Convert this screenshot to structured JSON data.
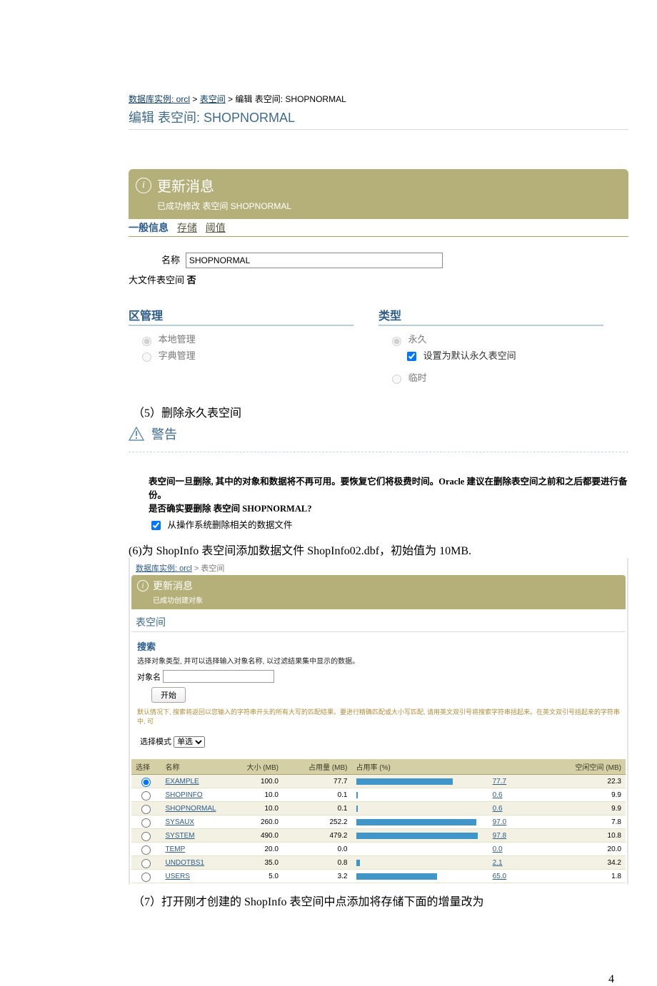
{
  "breadcrumb": {
    "db_link": "数据库实例: orcl",
    "ts_link": "表空间",
    "current": "编辑 表空间: SHOPNORMAL"
  },
  "page_title": "编辑 表空间: SHOPNORMAL",
  "update": {
    "title": "更新消息",
    "msg": "已成功修改 表空间 SHOPNORMAL"
  },
  "tabs": {
    "general": "一般信息",
    "storage": "存储",
    "threshold": "阈值"
  },
  "form": {
    "name_label": "名称",
    "name_value": "SHOPNORMAL",
    "bigfile_label": "大文件表空间",
    "bigfile_value": "否"
  },
  "section": {
    "extent": "区管理",
    "extent_local": "本地管理",
    "extent_dict": "字典管理",
    "type": "类型",
    "type_perm": "永久",
    "type_default_chk": "设置为默认永久表空间",
    "type_temp": "临时"
  },
  "step5": "（5）删除永久表空间",
  "warn": {
    "title": "警告",
    "line1a": "表空间一旦删除, 其中的对象和数据将不再可用。要恢复它们将极费时间。Oracle 建议在删除表空间之前和之后都要进行备份。",
    "line2": "是否确实要删除 表空间  SHOPNORMAL?",
    "checkbox": "从操作系统删除相关的数据文件"
  },
  "step6": "(6)为 ShopInfo 表空间添加数据文件 ShopInfo02.dbf，初始值为 10MB.",
  "inner_breadcrumb": {
    "db_link": "数据库实例: orcl",
    "current": "表空间"
  },
  "update2": {
    "title": "更新消息",
    "msg": "已成功创建对象"
  },
  "inner_title": "表空间",
  "search": {
    "title": "搜索",
    "desc": "选择对象类型, 并可以选择输入对象名称, 以过滤结果集中显示的数据。",
    "obj_label": "对象名",
    "start_btn": "开始",
    "hint": "默认情况下, 搜索将返回以您输入的字符串开头的所有大写的匹配结果。要进行精确匹配或大小写匹配, 请用英文双引号将搜索字符串括起来。在英文双引号括起来的字符串中, 可",
    "mode_label": "选择模式",
    "mode_value": "单选"
  },
  "table": {
    "headers": {
      "select": "选择",
      "name": "名称",
      "size": "大小  (MB)",
      "used": "占用量  (MB)",
      "pct": "占用率 (%)",
      "free": "空闲空间  (MB)"
    },
    "rows": [
      {
        "name": "EXAMPLE",
        "size": "100.0",
        "used": "77.7",
        "pct": "77.7",
        "bar": 135,
        "free": "22.3"
      },
      {
        "name": "SHOPINFO",
        "size": "10.0",
        "used": "0.1",
        "pct": "0.6",
        "bar": 2,
        "free": "9.9"
      },
      {
        "name": "SHOPNORMAL",
        "size": "10.0",
        "used": "0.1",
        "pct": "0.6",
        "bar": 2,
        "free": "9.9"
      },
      {
        "name": "SYSAUX",
        "size": "260.0",
        "used": "252.2",
        "pct": "97.0",
        "bar": 168,
        "free": "7.8"
      },
      {
        "name": "SYSTEM",
        "size": "490.0",
        "used": "479.2",
        "pct": "97.8",
        "bar": 170,
        "free": "10.8"
      },
      {
        "name": "TEMP",
        "size": "20.0",
        "used": "0.0",
        "pct": "0.0",
        "bar": 0,
        "free": "20.0"
      },
      {
        "name": "UNDOTBS1",
        "size": "35.0",
        "used": "0.8",
        "pct": "2.1",
        "bar": 5,
        "free": "34.2"
      },
      {
        "name": "USERS",
        "size": "5.0",
        "used": "3.2",
        "pct": "65.0",
        "bar": 113,
        "free": "1.8"
      }
    ]
  },
  "step7": "（7）打开刚才创建的 ShopInfo 表空间中点添加将存储下面的增量改为",
  "pagenum": "4"
}
